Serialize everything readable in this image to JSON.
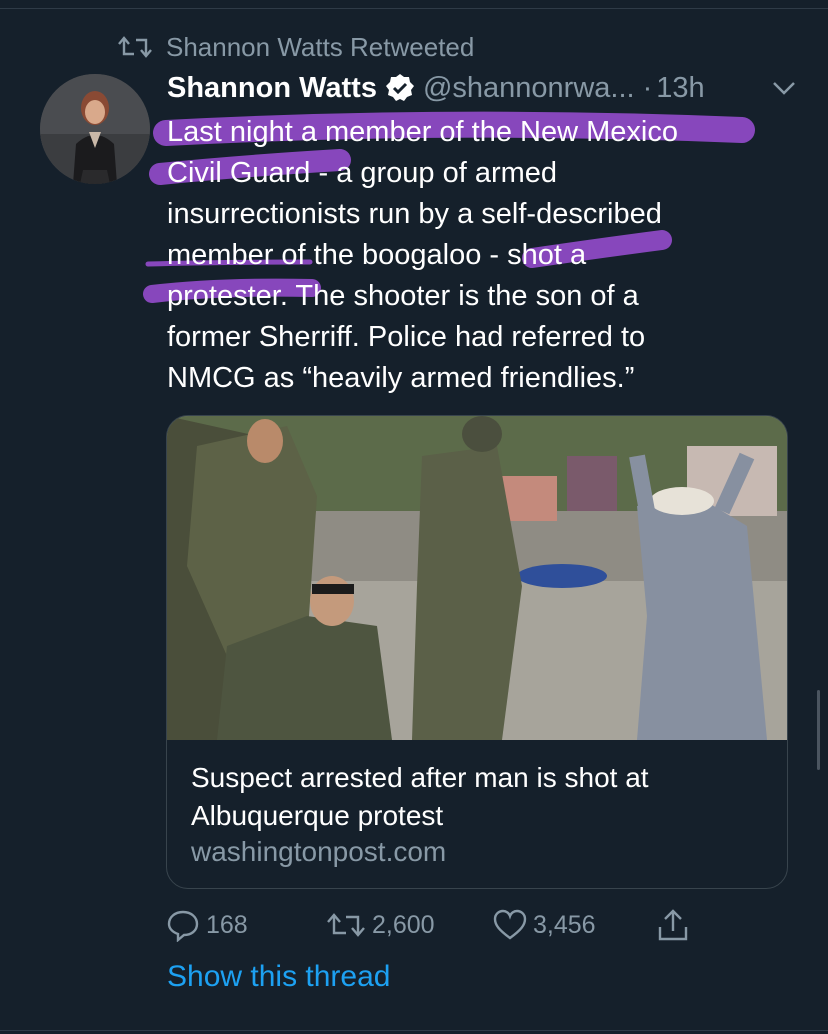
{
  "retweet_context": {
    "label": "Shannon Watts Retweeted",
    "icon": "retweet-icon"
  },
  "tweet": {
    "author_name": "Shannon Watts",
    "verified_icon": "verified-badge-icon",
    "handle": "@shannonrwa...",
    "separator": "·",
    "time": "13h",
    "lines": [
      "Last night a member of the New Mexico",
      "Civil Guard - a group of armed",
      "insurrectionists run by a self-described",
      "member of the boogaloo - shot a",
      "protester. The shooter is the son of a",
      "former Sherriff. Police had referred to",
      "NMCG as “heavily armed friendlies.”"
    ],
    "highlight_color": "#9b4fd6"
  },
  "card": {
    "title_line1": "Suspect arrested after man is shot at",
    "title_line2": "Albuquerque protest",
    "domain": "washingtonpost.com"
  },
  "actions": {
    "reply_count": "168",
    "retweet_count": "2,600",
    "like_count": "3,456"
  },
  "show_thread": "Show this thread",
  "colors": {
    "background": "#15202b",
    "secondary": "#8899a6",
    "accent": "#1da1f2",
    "border": "#38444d"
  }
}
